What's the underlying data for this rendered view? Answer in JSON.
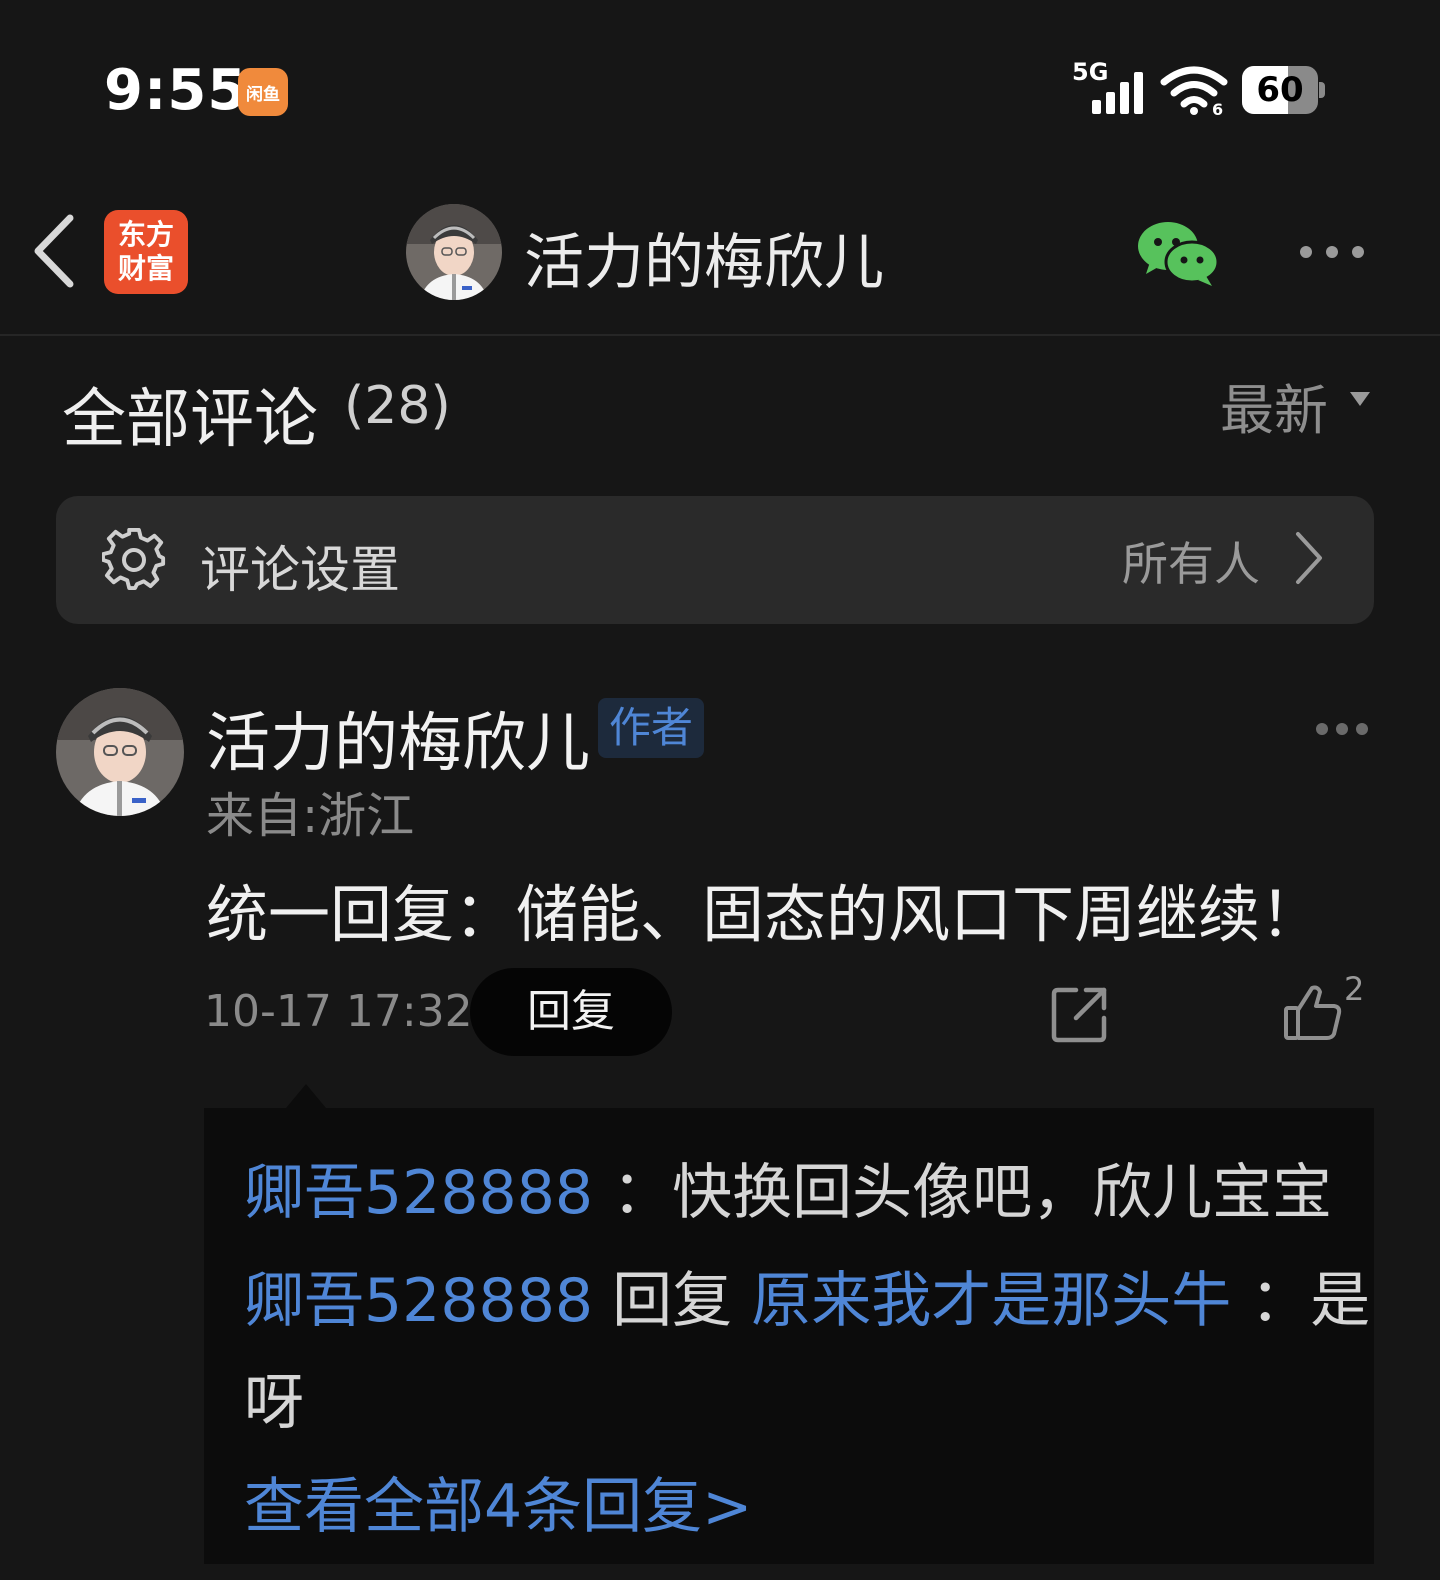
{
  "status_bar": {
    "time": "9:55",
    "app_icon_text": "闲鱼",
    "network": "5G",
    "battery": "60",
    "battery_level": 0.6
  },
  "nav": {
    "brand_line1": "东方",
    "brand_line2": "财富",
    "title": "活力的梅欣儿"
  },
  "comments_section": {
    "title": "全部评论",
    "count": "(28)",
    "sort_label": "最新"
  },
  "settings": {
    "label": "评论设置",
    "value": "所有人"
  },
  "comment": {
    "author": "活力的梅欣儿",
    "badge": "作者",
    "location": "来自:浙江",
    "text": "统一回复：储能、固态的风口下周继续！",
    "time": "10-17 17:32",
    "reply_label": "回复",
    "like_count": "2"
  },
  "replies": {
    "reply1_user": "卿吾528888",
    "reply1_text": "：快换回头像吧，欣儿宝宝",
    "reply2_user": "卿吾528888",
    "reply2_verb": "回复",
    "reply2_target": "原来我才是那头牛",
    "reply2_text_a": "：是",
    "reply2_text_b": "呀",
    "view_all": "查看全部4条回复>"
  },
  "colors": {
    "background": "#161616",
    "accent_blue": "#4f86d6",
    "brand_red": "#ea4f2c",
    "wechat_green": "#57c25c"
  },
  "icons": [
    "back-icon",
    "wechat-icon",
    "more-icon",
    "gear-icon",
    "chevron-right-icon",
    "share-icon",
    "like-icon",
    "sort-caret-icon"
  ]
}
